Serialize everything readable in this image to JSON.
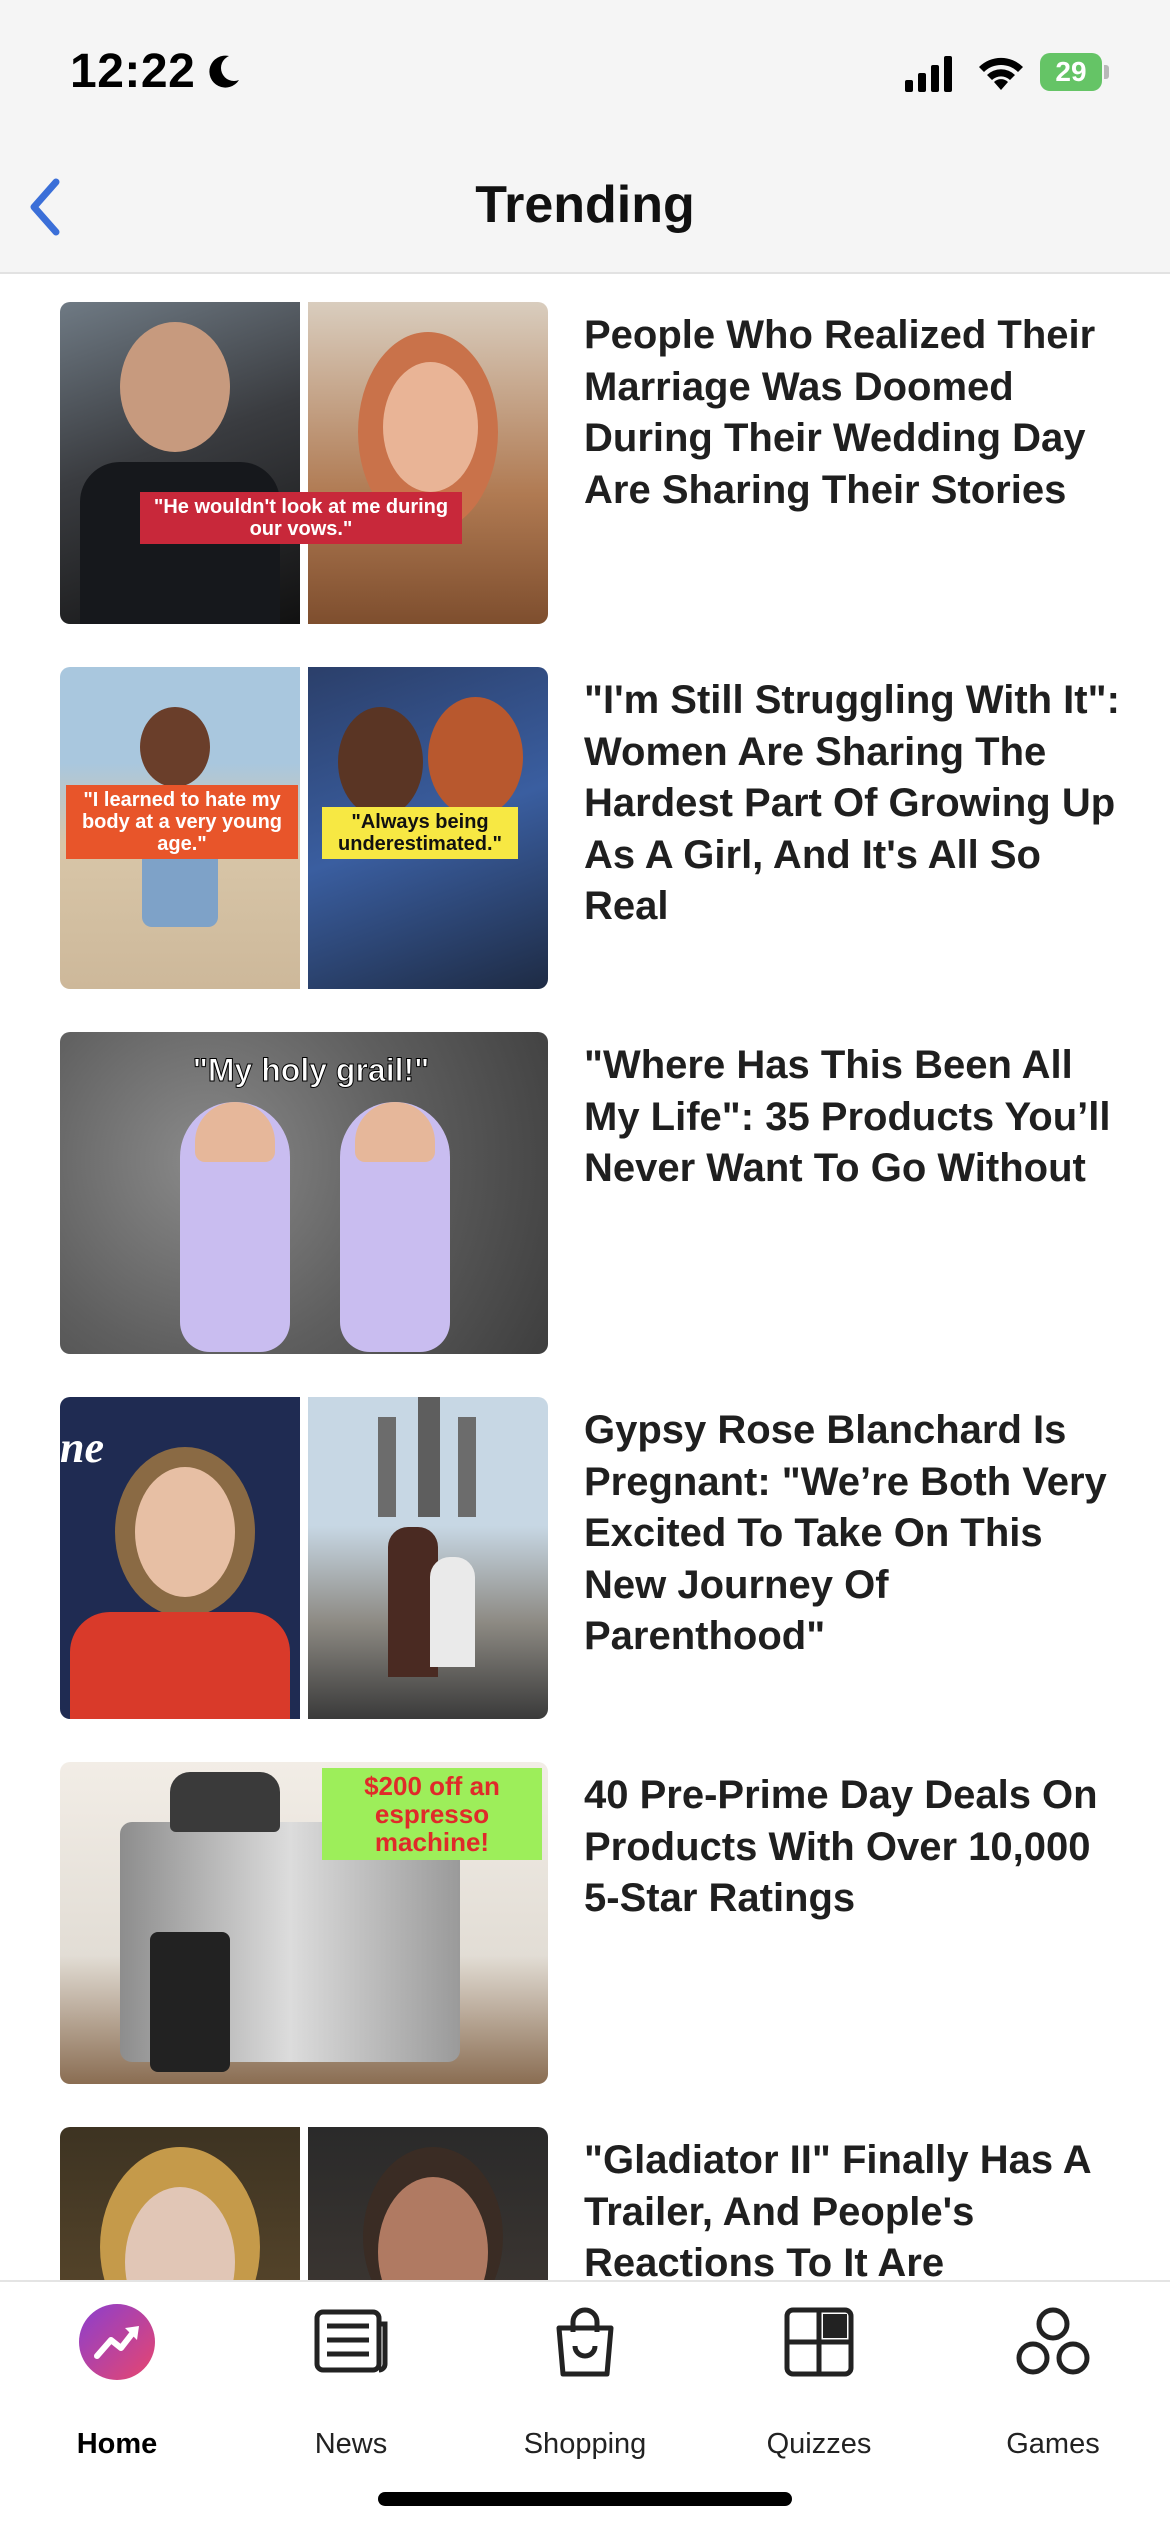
{
  "status_bar": {
    "time": "12:22",
    "battery": "29"
  },
  "header": {
    "title": "Trending"
  },
  "articles": [
    {
      "headline": "People Who Realized Their Marriage Was Doomed During Their Wedding Day Are Sharing Their Stories",
      "caption": "\"He wouldn't look at me during our vows.\""
    },
    {
      "headline": "\"I'm Still Struggling With It\": Women Are Sharing The Hardest Part Of Growing Up As A Girl, And It's All So Real",
      "caption_left": "\"I learned to hate my body at a very young age.\"",
      "caption_right": "\"Always being underestimated.\""
    },
    {
      "headline": "\"Where Has This Been All My Life\": 35 Products You’ll Never Want To Go Without",
      "caption": "\"My holy grail!\""
    },
    {
      "headline": "Gypsy Rose Blanchard Is Pregnant: \"We’re Both Very Excited To Take On This New Journey Of Parenthood\"",
      "caption": "ne"
    },
    {
      "headline": "40 Pre-Prime Day Deals On Products With Over 10,000 5-Star Ratings",
      "caption": "$200 off an espresso machine!"
    },
    {
      "headline": "\"Gladiator II\" Finally Has A Trailer, And People's Reactions To It Are"
    }
  ],
  "tabs": [
    {
      "label": "Home",
      "icon": "trending-icon",
      "active": true
    },
    {
      "label": "News",
      "icon": "news-icon",
      "active": false
    },
    {
      "label": "Shopping",
      "icon": "shopping-bag-icon",
      "active": false
    },
    {
      "label": "Quizzes",
      "icon": "quiz-grid-icon",
      "active": false
    },
    {
      "label": "Games",
      "icon": "games-icon",
      "active": false
    }
  ],
  "colors": {
    "accent": "#3b6fd8",
    "brand_purple": "#8a3fcf",
    "brand_pink": "#e8466e",
    "caption_red": "#c8283a",
    "caption_orange": "#e8552a",
    "caption_yellow": "#f7e843",
    "caption_green": "#9dee5a",
    "battery_green": "#65c466"
  }
}
